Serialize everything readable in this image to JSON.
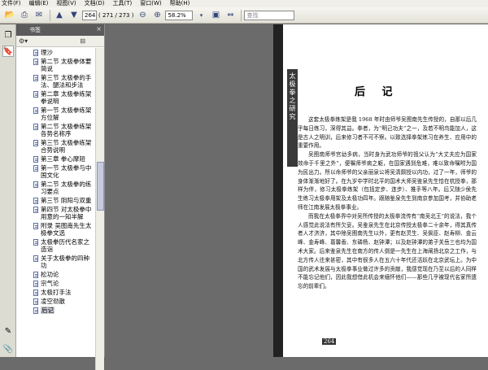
{
  "menu": [
    "文件(F)",
    "编辑(E)",
    "视图(V)",
    "文档(D)",
    "工具(T)",
    "窗口(W)",
    "帮助(H)"
  ],
  "toolbar": {
    "page_current": "264",
    "page_of": "( 271 / 273 )",
    "zoom": "58.2%",
    "search_placeholder": "查找"
  },
  "sidebar": {
    "title": "书签",
    "close": "×",
    "items": [
      {
        "label": "理沙"
      },
      {
        "label": "第二节 太极拳体要简说"
      },
      {
        "label": "第三节 太极拳的手法、腿法和步法"
      },
      {
        "label": "第二章 太极拳练架拳说明"
      },
      {
        "label": "第一节 太极拳练架方位解"
      },
      {
        "label": "第二节 太极拳练架各势名称序"
      },
      {
        "label": "第三节 太极拳练架合势说明"
      },
      {
        "label": "第三章 拳心摩短"
      },
      {
        "label": "第一节 太极拳与中国文化"
      },
      {
        "label": "第二节 太极拳的练习要点"
      },
      {
        "label": "第三节 阴阳与双重"
      },
      {
        "label": "第四节 对太极拳中用意的一知半解"
      },
      {
        "label": "附录 吴图南先生太极拳文选"
      },
      {
        "label": "太极拳历代名家之造诣"
      },
      {
        "label": "关于太极拳的四种功"
      },
      {
        "label": "松功论"
      },
      {
        "label": "宗气论"
      },
      {
        "label": "太极打手法"
      },
      {
        "label": "凌空劲散"
      },
      {
        "label": "后记",
        "selected": true
      }
    ]
  },
  "page": {
    "spine_text": [
      "太",
      "极",
      "拳",
      "之",
      "研",
      "究"
    ],
    "heading": "后 记",
    "paragraphs": [
      "这套太极拳练架是我 1968 年时由师爷吴图南先生传授的，自那以后几乎每日练习，深得其益。拳者，为“明己功夫”之一，及若不明鸟能加人，这是古人之明训，后来修习者不可不察。以致选择拳架练习在养生、应用中的重要作用。",
      "吴图南师爷宫幼多病，当时身为武功师爷的祖父认为“大丈夫应为国家效命于千里之外”，便嘱师爷病之躯，在国家遇到危难，难以致命嘱咐为国为民出力。所以命师爷的父亲丽泉公将吴清颇授以内功，过了一年，师爷的身体渐渐地好了。在九岁中学时北平的国术大师吴鉴泉先生恰在杭授拳，那样为伴，修习太极拳练架（包括定步、连步）、推手等八年。后又随少侯先生练习太极拳用架及太极功四年。跟随鉴泉先生到南京参加国考，并协助老师在江南发展太极拳事业。",
      "而我在太极拳界中对吴所传授的太极拳流传有“南吴北王”的说法，我个人感觉此说法有所欠妥。吴鉴泉先生在北京传授太极拳二十余年，得其真传者人才济济，其中除吴图南先生以外，更有赵灵生、吴佩臣、赵寿柳、金云峰、金寿峰、葛馨香、东磷杨、赵钟潭；以及赵钟潭的弟子关岳三也均为国术大家。后来鉴泉先生在南方的传人倒是一先生在上海阐扬北京之工作，与北方传人往来甚密，其中有很多人在五六十年代还活跃在北京武坛上。为中国的武术发展与太极拳事业做过许多的贡献，我感觉现在乃至以后的人同样不能忘记他们，因此我想借此机会来缅怀他们——那些几乎被现代名家所遗忘的前辈们。"
    ],
    "page_number": "264"
  }
}
